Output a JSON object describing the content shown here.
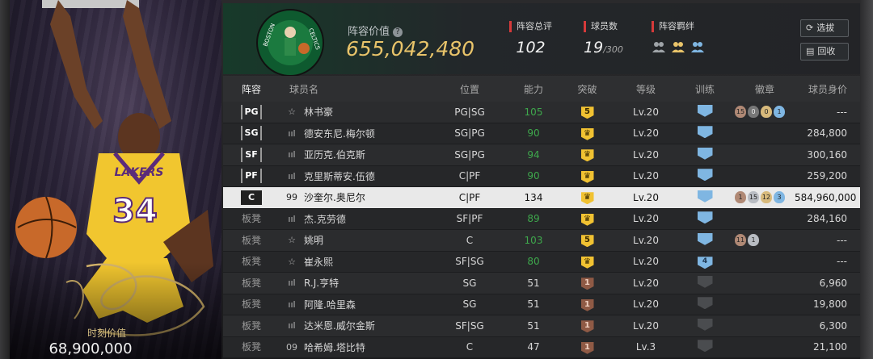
{
  "card": {
    "market_value_label": "时刻价值",
    "market_value": "68,900,000",
    "jersey_team": "LAKERS",
    "jersey_number": "34"
  },
  "header": {
    "lineup_value_label": "阵容价值",
    "lineup_value": "655,042,480",
    "total_rating_label": "阵容总评",
    "total_rating": "102",
    "player_count_label": "球员数",
    "player_count": "19",
    "player_count_max": "/300",
    "bond_label": "阵容羁绊",
    "logo_text_left": "BOSTON",
    "logo_text_right": "CELTICS",
    "buttons": {
      "select": "选拔",
      "recycle": "回收"
    }
  },
  "table": {
    "headers": {
      "lineup": "阵容",
      "name": "球员名",
      "position": "位置",
      "ability": "能力",
      "breakthrough": "突破",
      "level": "等级",
      "training": "训练",
      "badges": "徽章",
      "value": "球员身价"
    },
    "rows": [
      {
        "slot": "PG",
        "rank": "☆",
        "name": "林书豪",
        "position": "PG|SG",
        "ability": "105",
        "brk": "5",
        "brk_type": "gold",
        "level": "Lv.20",
        "trn": "",
        "trn_dim": false,
        "badges": [
          [
            "15",
            "bronze"
          ],
          [
            "0",
            "gray"
          ],
          [
            "0",
            "gold"
          ],
          [
            "1",
            "blue"
          ]
        ],
        "value": "---"
      },
      {
        "slot": "SG",
        "rank": "ııl",
        "name": "德安东尼.梅尔顿",
        "position": "SG|PG",
        "ability": "90",
        "brk": "♛",
        "brk_type": "gold",
        "level": "Lv.20",
        "trn": "",
        "trn_dim": false,
        "badges": [],
        "value": "284,800"
      },
      {
        "slot": "SF",
        "rank": "ııl",
        "name": "亚历克.伯克斯",
        "position": "SG|PG",
        "ability": "94",
        "brk": "♛",
        "brk_type": "gold",
        "level": "Lv.20",
        "trn": "",
        "trn_dim": false,
        "badges": [],
        "value": "300,160"
      },
      {
        "slot": "PF",
        "rank": "ııl",
        "name": "克里斯蒂安.伍德",
        "position": "C|PF",
        "ability": "90",
        "brk": "♛",
        "brk_type": "gold",
        "level": "Lv.20",
        "trn": "",
        "trn_dim": false,
        "badges": [],
        "value": "259,200"
      },
      {
        "slot": "C",
        "rank": "99",
        "name": "沙奎尔.奥尼尔",
        "position": "C|PF",
        "ability": "134",
        "brk": "♛",
        "brk_type": "gold",
        "level": "Lv.20",
        "trn": "",
        "trn_dim": false,
        "badges": [
          [
            "1",
            "bronze"
          ],
          [
            "15",
            "silver"
          ],
          [
            "12",
            "gold"
          ],
          [
            "3",
            "blue"
          ]
        ],
        "value": "584,960,000",
        "selected": true
      },
      {
        "slot": "板凳",
        "rank": "ııl",
        "name": "杰.克劳德",
        "position": "SF|PF",
        "ability": "89",
        "brk": "♛",
        "brk_type": "gold",
        "level": "Lv.20",
        "trn": "",
        "trn_dim": false,
        "badges": [],
        "value": "284,160"
      },
      {
        "slot": "板凳",
        "rank": "☆",
        "name": "姚明",
        "position": "C",
        "ability": "103",
        "brk": "5",
        "brk_type": "gold",
        "level": "Lv.20",
        "trn": "",
        "trn_dim": false,
        "badges": [
          [
            "11",
            "bronze"
          ],
          [
            "1",
            "silver"
          ]
        ],
        "value": "---"
      },
      {
        "slot": "板凳",
        "rank": "☆",
        "name": "崔永熙",
        "position": "SF|SG",
        "ability": "80",
        "brk": "♛",
        "brk_type": "gold",
        "level": "Lv.20",
        "trn": "4",
        "trn_dim": false,
        "badges": [],
        "value": "---"
      },
      {
        "slot": "板凳",
        "rank": "ııl",
        "name": "R.J.亨特",
        "position": "SG",
        "ability": "51",
        "brk": "1",
        "brk_type": "bronze",
        "level": "Lv.20",
        "trn": "",
        "trn_dim": true,
        "badges": [],
        "value": "6,960"
      },
      {
        "slot": "板凳",
        "rank": "ııl",
        "name": "阿隆.哈里森",
        "position": "SG",
        "ability": "51",
        "brk": "1",
        "brk_type": "bronze",
        "level": "Lv.20",
        "trn": "",
        "trn_dim": true,
        "badges": [],
        "value": "19,800"
      },
      {
        "slot": "板凳",
        "rank": "ııl",
        "name": "达米恩.威尔金斯",
        "position": "SF|SG",
        "ability": "51",
        "brk": "1",
        "brk_type": "bronze",
        "level": "Lv.20",
        "trn": "",
        "trn_dim": true,
        "badges": [],
        "value": "6,300"
      },
      {
        "slot": "板凳",
        "rank": "09",
        "name": "哈希姆.塔比特",
        "position": "C",
        "ability": "47",
        "brk": "1",
        "brk_type": "bronze",
        "level": "Lv.3",
        "trn": "",
        "trn_dim": true,
        "badges": [],
        "value": "21,100"
      }
    ]
  },
  "colors": {
    "accent_gold": "#e9c46a",
    "ability_green": "#3ea84c",
    "title_red": "#d63a3a",
    "training_blue": "#7fb6e2"
  }
}
